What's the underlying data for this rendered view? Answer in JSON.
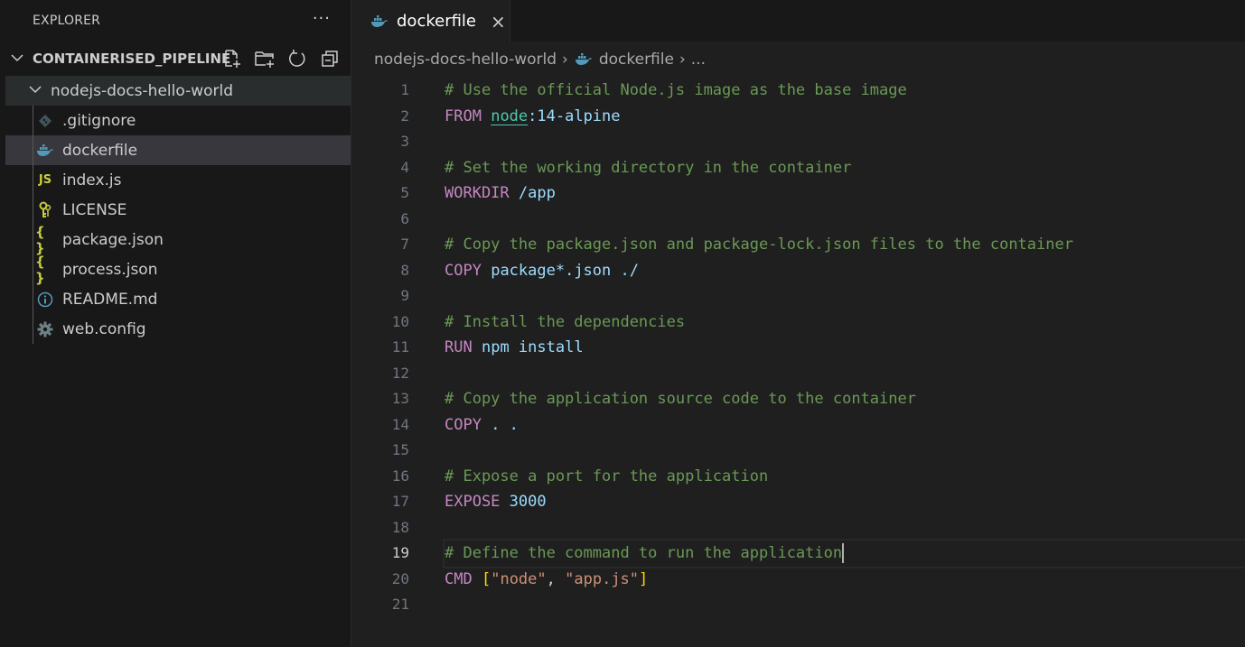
{
  "sidebar": {
    "title": "EXPLORER",
    "more_icon": "ellipsis-icon",
    "root": {
      "label": "CONTAINERISED_PIPELINE",
      "actions": [
        "new-file-icon",
        "new-folder-icon",
        "refresh-icon",
        "collapse-all-icon"
      ]
    },
    "folder": {
      "label": "nodejs-docs-hello-world"
    },
    "files": [
      {
        "label": ".gitignore",
        "icon": "git-icon",
        "color": "#41535b"
      },
      {
        "label": "dockerfile",
        "icon": "docker-icon",
        "color": "#519aba",
        "selected": true
      },
      {
        "label": "index.js",
        "icon": "javascript-icon",
        "color": "#cbcb41"
      },
      {
        "label": "LICENSE",
        "icon": "license-icon",
        "color": "#cbcb41"
      },
      {
        "label": "package.json",
        "icon": "json-icon",
        "color": "#cbcb41"
      },
      {
        "label": "process.json",
        "icon": "json-icon",
        "color": "#cbcb41"
      },
      {
        "label": "README.md",
        "icon": "info-icon",
        "color": "#519aba"
      },
      {
        "label": "web.config",
        "icon": "gear-icon",
        "color": "#6d8086"
      }
    ]
  },
  "editor": {
    "tab": {
      "label": "dockerfile",
      "close": "×"
    },
    "breadcrumb": {
      "folder": "nodejs-docs-hello-world",
      "sep": "›",
      "file": "dockerfile",
      "more": "..."
    },
    "active_line": 19,
    "lines": [
      {
        "n": "1",
        "t": "# Use the official Node.js image as the base image"
      },
      {
        "n": "2",
        "t": "FROM node:14-alpine"
      },
      {
        "n": "3",
        "t": ""
      },
      {
        "n": "4",
        "t": "# Set the working directory in the container"
      },
      {
        "n": "5",
        "t": "WORKDIR /app"
      },
      {
        "n": "6",
        "t": ""
      },
      {
        "n": "7",
        "t": "# Copy the package.json and package-lock.json files to the container"
      },
      {
        "n": "8",
        "t": "COPY package*.json ./"
      },
      {
        "n": "9",
        "t": ""
      },
      {
        "n": "10",
        "t": "# Install the dependencies"
      },
      {
        "n": "11",
        "t": "RUN npm install"
      },
      {
        "n": "12",
        "t": ""
      },
      {
        "n": "13",
        "t": "# Copy the application source code to the container"
      },
      {
        "n": "14",
        "t": "COPY . ."
      },
      {
        "n": "15",
        "t": ""
      },
      {
        "n": "16",
        "t": "# Expose a port for the application"
      },
      {
        "n": "17",
        "t": "EXPOSE 3000"
      },
      {
        "n": "18",
        "t": ""
      },
      {
        "n": "19",
        "t": "# Define the command to run the application"
      },
      {
        "n": "20",
        "t": "CMD [\"node\", \"app.js\"]"
      },
      {
        "n": "21",
        "t": ""
      }
    ]
  }
}
